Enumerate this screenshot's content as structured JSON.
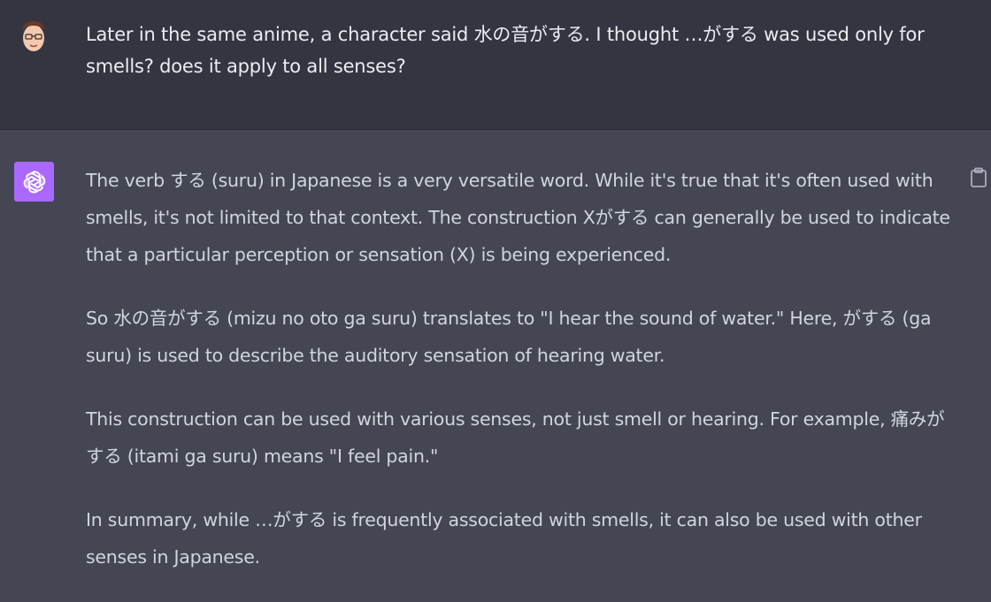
{
  "user_message": {
    "text": "Later in the same anime, a character said 水の音がする. I thought …がする was used only for smells? does it apply to all senses?"
  },
  "assistant_message": {
    "paragraphs": [
      "The verb する (suru) in Japanese is a very versatile word. While it's true that it's often used with smells, it's not limited to that context. The construction Xがする can generally be used to indicate that a particular perception or sensation (X) is being experienced.",
      "So 水の音がする (mizu no oto ga suru) translates to \"I hear the sound of water.\" Here, がする (ga suru) is used to describe the auditory sensation of hearing water.",
      "This construction can be used with various senses, not just smell or hearing. For example, 痛みがする (itami ga suru) means \"I feel pain.\"",
      "In summary, while …がする is frequently associated with smells, it can also be used with other senses in Japanese."
    ]
  },
  "icons": {
    "user_avatar": "user-avatar-icon",
    "assistant_avatar": "openai-logo-icon",
    "copy": "clipboard-icon"
  },
  "colors": {
    "user_bg": "#343541",
    "assistant_bg": "#444654",
    "assistant_avatar_bg": "#ab68ff",
    "user_text": "#ececf1",
    "assistant_text": "#d1d5db"
  }
}
